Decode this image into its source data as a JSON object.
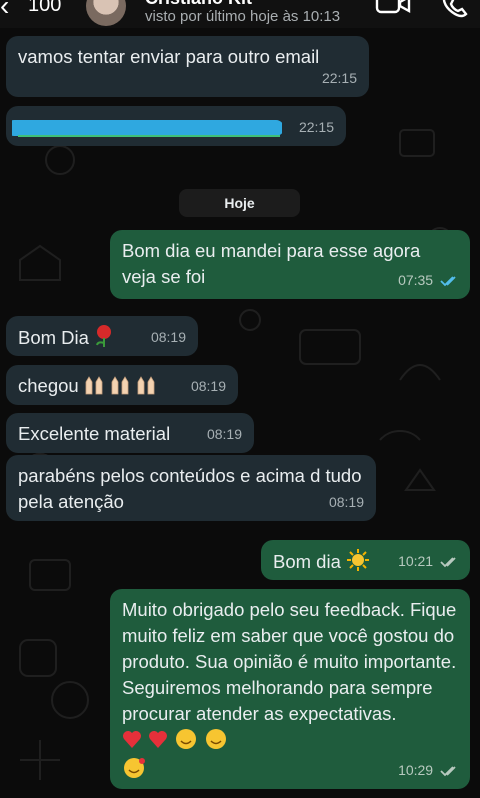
{
  "header": {
    "back_count": "100",
    "contact_name": "Cristiano Kit",
    "status": "visto por último hoje às 10:13"
  },
  "day_separator": "Hoje",
  "messages": [
    {
      "dir": "in",
      "text": "vamos tentar enviar para outro email",
      "time": "22:15"
    },
    {
      "dir": "in",
      "text": "",
      "time": "22:15",
      "redacted": true
    },
    {
      "dir": "out",
      "text": "Bom dia eu mandei para esse agora veja se foi",
      "time": "07:35",
      "status": "read"
    },
    {
      "dir": "in",
      "text": "Bom Dia",
      "emoji": "rose",
      "time": "08:19"
    },
    {
      "dir": "in",
      "text": "chegou",
      "emoji": "raising-hands x3",
      "time": "08:19"
    },
    {
      "dir": "in",
      "text": "Excelente material",
      "time": "08:19"
    },
    {
      "dir": "in",
      "text": "parabéns pelos conteúdos e acima d tudo pela atenção",
      "time": "08:19"
    },
    {
      "dir": "out",
      "text": "Bom dia",
      "emoji": "sun",
      "time": "10:21",
      "status": "delivered"
    },
    {
      "dir": "out",
      "text": "Muito obrigado pelo seu feedback. Fique muito feliz em saber que você gostou do produto. Sua opinião é muito importante. Seguiremos melhorando para sempre procurar atender as expectativas.",
      "emoji": "hearts and smiling faces",
      "time": "10:29",
      "status": "delivered"
    }
  ],
  "colors": {
    "background": "#0b0b0b",
    "incoming_bubble": "#202c33",
    "outgoing_bubble": "#1f5c3d",
    "read_ticks": "#53bdeb"
  }
}
